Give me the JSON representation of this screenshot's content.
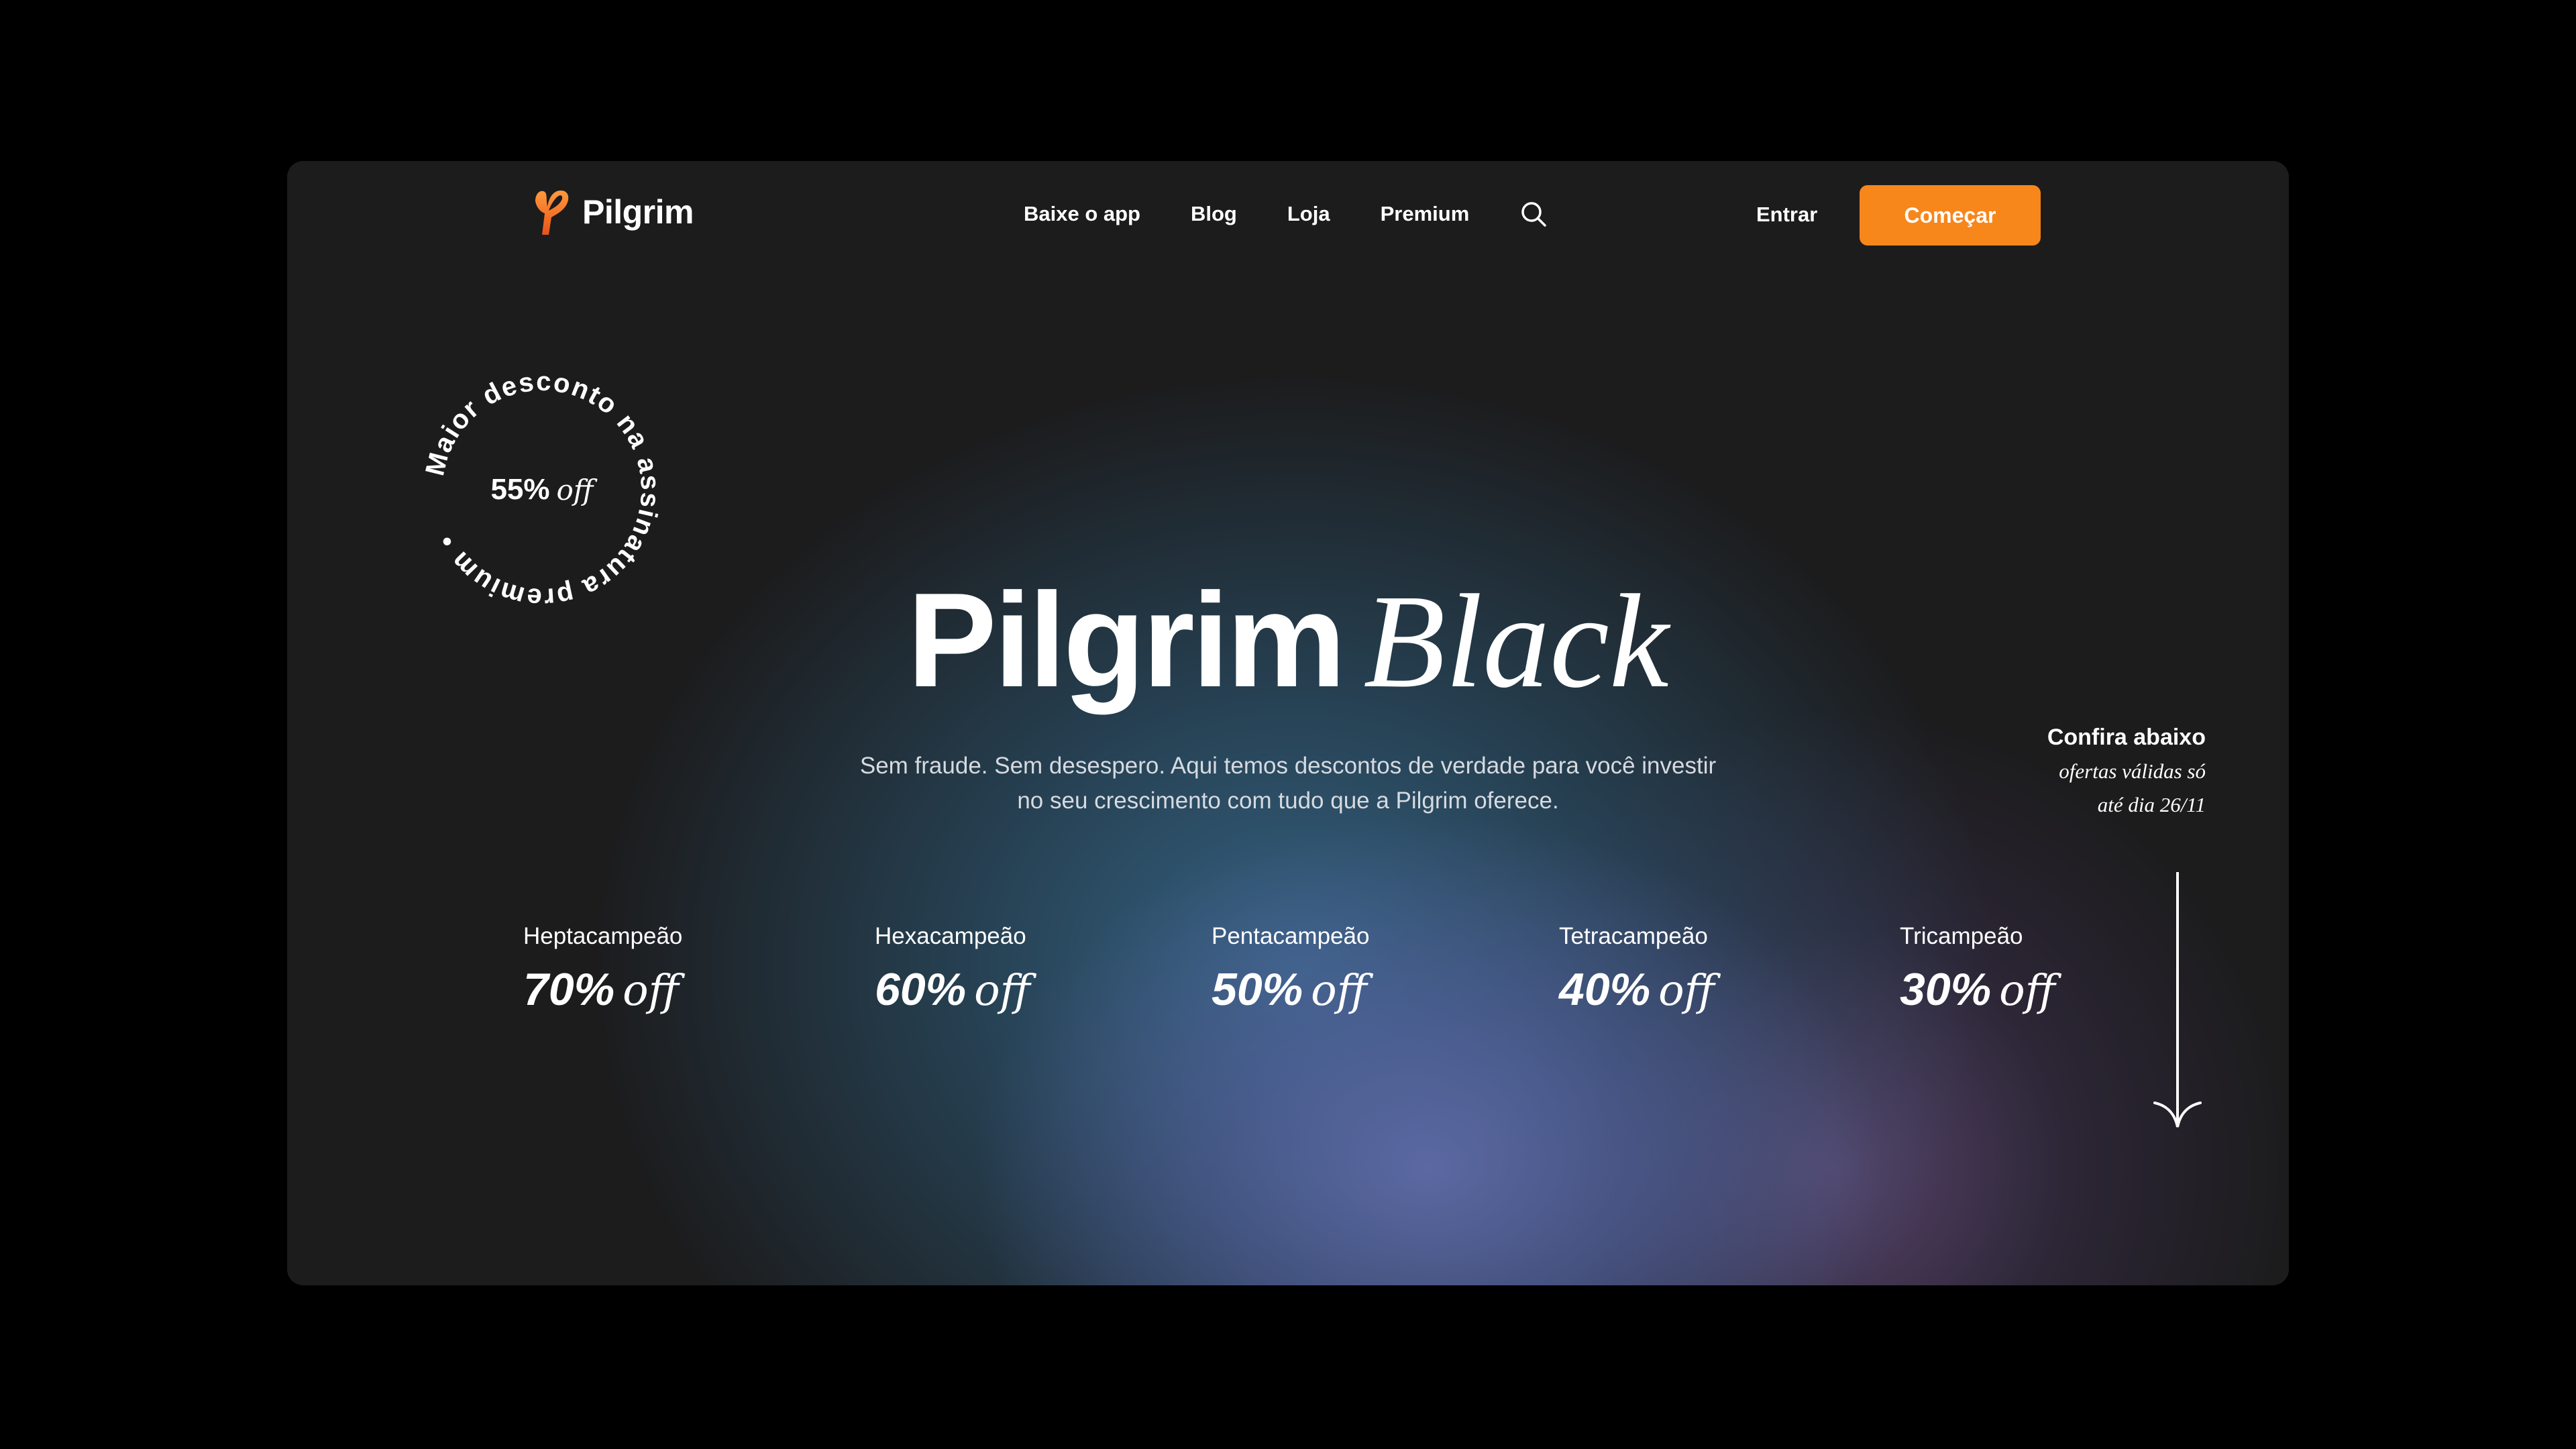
{
  "brand": {
    "name": "Pilgrim",
    "accent": "#f7861b"
  },
  "nav": {
    "links": [
      "Baixe o app",
      "Blog",
      "Loja",
      "Premium"
    ],
    "search_icon": "search-icon",
    "login": "Entrar",
    "cta": "Começar"
  },
  "badge": {
    "ring_text": "Maior desconto na assinatura premium •",
    "percent": "55%",
    "off": "off"
  },
  "hero": {
    "title_bold": "Pilgrim",
    "title_italic": "Black",
    "subtitle": "Sem fraude. Sem desespero. Aqui temos descontos de verdade para você investir no seu crescimento com tudo que a Pilgrim oferece."
  },
  "note": {
    "title": "Confira abaixo",
    "line1": "ofertas válidas só",
    "line2": "até dia 26/11"
  },
  "discounts": [
    {
      "label": "Heptacampeão",
      "percent": "70%",
      "off": "off"
    },
    {
      "label": "Hexacampeão",
      "percent": "60%",
      "off": "off"
    },
    {
      "label": "Pentacampeão",
      "percent": "50%",
      "off": "off"
    },
    {
      "label": "Tetracampeão",
      "percent": "40%",
      "off": "off"
    },
    {
      "label": "Tricampeão",
      "percent": "30%",
      "off": "off"
    }
  ]
}
